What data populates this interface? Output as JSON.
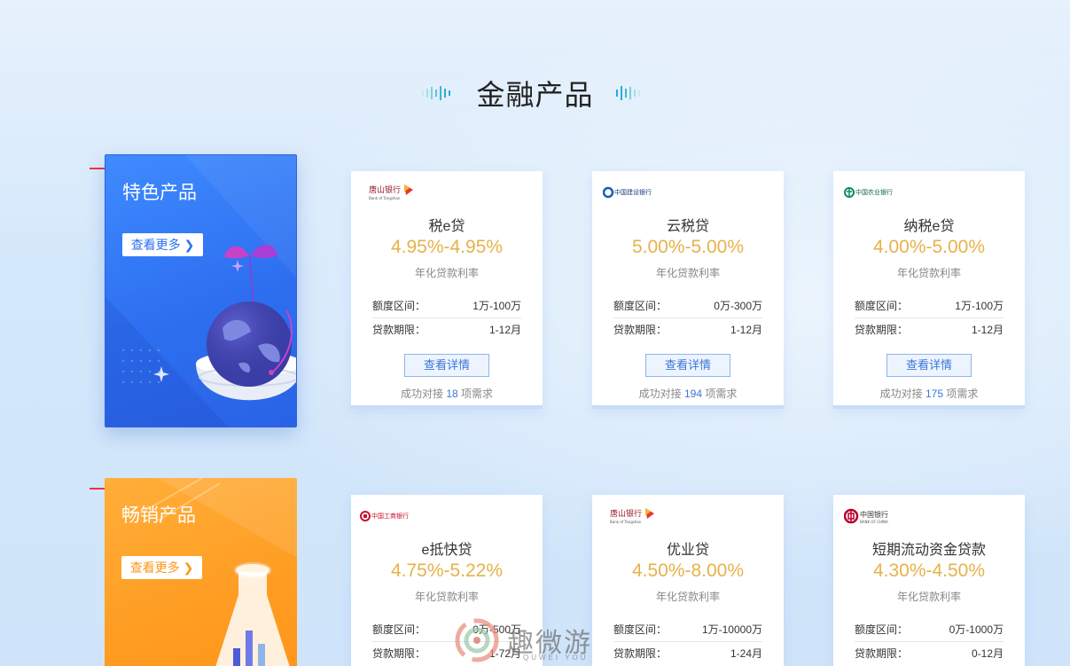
{
  "section": {
    "title": "金融产品"
  },
  "featured": [
    {
      "title": "特色产品",
      "more_label": "查看更多 ❯",
      "color": "#2d6ff0"
    },
    {
      "title": "畅销产品",
      "more_label": "查看更多 ❯",
      "color": "#ff951a"
    }
  ],
  "labels": {
    "rate_label": "年化贷款利率",
    "amount_label": "额度区间：",
    "term_label": "贷款期限：",
    "detail_button": "查看详情",
    "success_prefix": "成功对接",
    "success_suffix": "项需求"
  },
  "products": [
    {
      "bank_icon": "tangshan-bank-logo",
      "name": "税e贷",
      "rate": "4.95%-4.95%",
      "amount": "1万-100万",
      "term": "1-12月",
      "success_count": "18"
    },
    {
      "bank_icon": "ccb-logo",
      "name": "云税贷",
      "rate": "5.00%-5.00%",
      "amount": "0万-300万",
      "term": "1-12月",
      "success_count": "194"
    },
    {
      "bank_icon": "abc-logo",
      "name": "纳税e贷",
      "rate": "4.00%-5.00%",
      "amount": "1万-100万",
      "term": "1-12月",
      "success_count": "175"
    },
    {
      "bank_icon": "icbc-logo",
      "name": "e抵快贷",
      "rate": "4.75%-5.22%",
      "amount": "0万-500万",
      "term": "1-72月"
    },
    {
      "bank_icon": "tangshan-bank-logo",
      "name": "优业贷",
      "rate": "4.50%-8.00%",
      "amount": "1万-10000万",
      "term": "1-24月"
    },
    {
      "bank_icon": "boc-logo",
      "name": "短期流动资金贷款",
      "rate": "4.30%-4.50%",
      "amount": "0万-1000万",
      "term": "0-12月"
    }
  ],
  "watermark": {
    "text": "趣微游",
    "sub": "QUWEI YOU"
  },
  "colors": {
    "rate": "#e6b24a",
    "link": "#3a76d8",
    "accent_red": "#e83a3a"
  }
}
